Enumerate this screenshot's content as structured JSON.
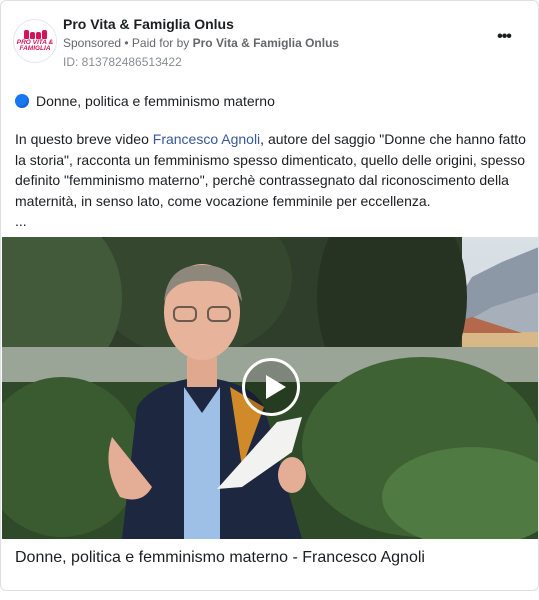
{
  "header": {
    "page_name": "Pro Vita & Famiglia Onlus",
    "avatar_text": "PRO VITA & FAMIGLIA",
    "sponsored_label": "Sponsored",
    "separator": " • ",
    "paid_for_prefix": "Paid for by ",
    "paid_for_by": "Pro Vita & Famiglia Onlus",
    "ad_id": "ID: 813782486513422",
    "more_icon": "more-horizontal-icon",
    "more_label": "•••"
  },
  "post": {
    "title_icon": "blue-circle-icon",
    "title": "Donne, politica e femminismo materno",
    "body_before": "In questo breve video ",
    "body_mention": "Francesco Agnoli",
    "body_after": ", autore del saggio \"Donne che hanno fatto la storia\", racconta un femminismo spesso dimenticato, quello delle origini, spesso definito \"femminismo materno\", perchè contrassegnato dal riconoscimento della maternità, in senso lato, come vocazione femminile per eccellenza.",
    "ellipsis": "..."
  },
  "media": {
    "type": "video",
    "play_icon": "play-icon",
    "caption": "Donne, politica e femminismo materno - Francesco Agnoli"
  },
  "colors": {
    "brand_pink": "#d4145a",
    "link_blue": "#385898",
    "dot_blue": "#1877f2",
    "text": "#1c1e21",
    "muted": "#65676b"
  }
}
